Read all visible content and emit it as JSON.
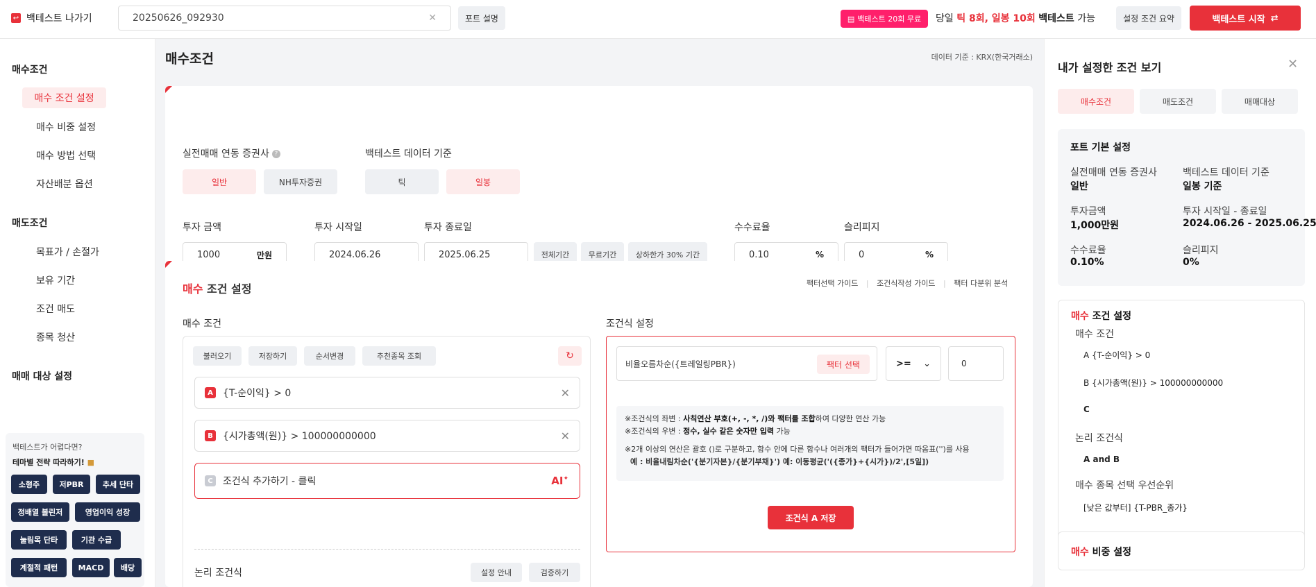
{
  "topbar": {
    "back_label": "백테스트 나가기",
    "search_value": "20250626_092930",
    "port_desc_button": "포트 설명",
    "badge": "백테스트 20회 무료",
    "count_prefix": "당일",
    "count_tick": "틱 8회, 일봉 10회",
    "count_suffix_bold": "백테스트",
    "count_suffix": "가능",
    "summary_button": "설정 조건 요약",
    "start_button": "백테스트 시작"
  },
  "sidebar": {
    "buy_head": "매수조건",
    "buy_items": [
      "매수 조건 설정",
      "매수 비중 설정",
      "매수 방법 선택",
      "자산배분 옵션"
    ],
    "sell_head": "매도조건",
    "sell_items": [
      "목표가 / 손절가",
      "보유 기간",
      "조건 매도",
      "종목 청산"
    ],
    "target_head": "매매 대상 설정",
    "promo_question": "백테스트가 어렵다면?",
    "promo_title": "테마별 전략 따라하기!",
    "chips": [
      "소형주",
      "저PBR",
      "추세 단타",
      "정배열 볼린저",
      "영업이익 성장",
      "눌림목 단타",
      "기관 수급",
      "계절적 패턴",
      "MACD",
      "배당"
    ]
  },
  "main": {
    "title": "매수조건",
    "data_source": "데이터 기준 : KRX(한국거래소)",
    "broker_label": "실전매매 연동 증권사",
    "broker_options": [
      "일반",
      "NH투자증권"
    ],
    "data_label": "백테스트 데이터 기준",
    "data_options": [
      "틱",
      "일봉"
    ],
    "invest_amount_label": "투자 금액",
    "invest_amount_value": "1000",
    "invest_amount_unit": "만원",
    "start_date_label": "투자 시작일",
    "start_date_value": "2024.06.26",
    "end_date_label": "투자 종료일",
    "end_date_value": "2025.06.25",
    "period_buttons": [
      "전체기간",
      "무료기간",
      "상하한가 30% 기간"
    ],
    "fee_label": "수수료율",
    "fee_value": "0.10",
    "fee_unit": "%",
    "slippage_label": "슬리피지",
    "slippage_value": "0",
    "slippage_unit": "%"
  },
  "buy_section": {
    "title_red": "매수",
    "title_rest": "조건 설정",
    "links": [
      "팩터선택 가이드",
      "조건식작성 가이드",
      "팩터 다분위 분석"
    ],
    "cond_label": "매수 조건",
    "formula_label": "조건식 설정",
    "toolbar": [
      "불러오기",
      "저장하기",
      "순서변경",
      "추천종목 조회"
    ],
    "conditions": [
      {
        "letter": "A",
        "text": "{T-순이익} > 0"
      },
      {
        "letter": "B",
        "text": "{시가총액(원)} > 100000000000"
      }
    ],
    "add_letter": "C",
    "add_text": "조건식 추가하기 - 클릭",
    "ai_label": "AI",
    "logic_label": "논리 조건식",
    "logic_buttons": [
      "설정 안내",
      "검증하기"
    ],
    "factor_value": "비율오름차순({트레일링PBR})",
    "factor_button": "팩터 선택",
    "operator": ">=",
    "compare_value": "0",
    "note1_prefix": "※조건식의 좌변 :",
    "note1_bold": "사칙연산 부호(+, -, *, /)와 팩터를 조합",
    "note1_suffix": "하여 다양한 연산 가능",
    "note2_prefix": "※조건식의 우변 :",
    "note2_bold": "정수, 실수 같은 숫자만 입력",
    "note2_suffix": "가능",
    "note3": "※2개 이상의 연산은 괄호 ()로 구분하고, 함수 안에 다른 함수나 여러개의 팩터가 들어가면 따옴표('')를 사용",
    "note4": "예 : 비율내림차순('{분기자본}/{분기부채}')   예: 이동평균('({종가}+{시가})/2',[5일])",
    "save_button": "조건식 A 저장"
  },
  "right_panel": {
    "title": "내가 설정한 조건 보기",
    "tabs": [
      "매수조건",
      "매도조건",
      "매매대상"
    ],
    "basic_title": "포트 기본 설정",
    "kv": [
      {
        "k": "실전매매 연동 증권사",
        "v": "일반"
      },
      {
        "k": "백테스트 데이터 기준",
        "v": "일봉 기준"
      },
      {
        "k": "투자금액",
        "v": "1,000만원"
      },
      {
        "k": "투자 시작일 - 종료일",
        "v": "2024.06.26 - 2025.06.25"
      },
      {
        "k": "수수료율",
        "v": "0.10%"
      },
      {
        "k": "슬리피지",
        "v": "0%"
      }
    ],
    "buy_title_red": "매수",
    "buy_title_rest": "조건 설정",
    "buy_cond_head": "매수 조건",
    "buy_lines": [
      "A {T-순이익} > 0",
      "B {시가총액(원)} > 100000000000",
      "C"
    ],
    "logic_head": "논리 조건식",
    "logic_value": "A and B",
    "priority_head": "매수 종목 선택 우선순위",
    "priority_value": "[낮은 값부터] {T-PBR_종가}",
    "weight_title_red": "매수",
    "weight_title_rest": "비중 설정"
  }
}
